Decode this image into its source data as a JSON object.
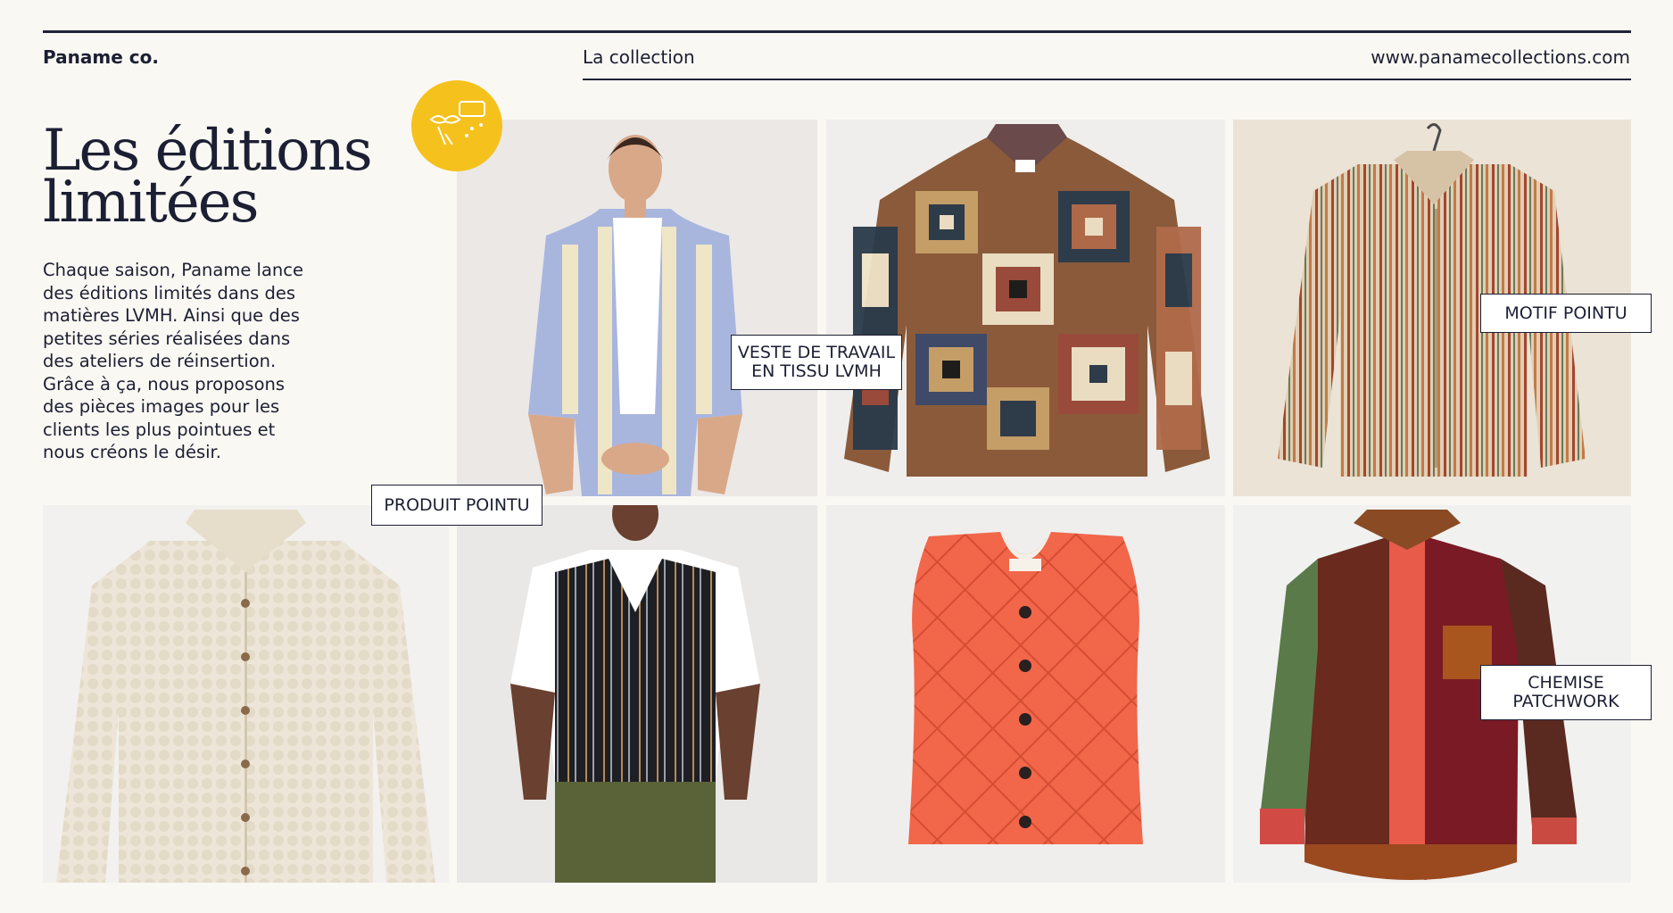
{
  "header": {
    "brand": "Paname co.",
    "nav_link": "La collection",
    "website": "www.panamecollections.com"
  },
  "intro": {
    "title_line1": "Les éditions",
    "title_line2": "limitées",
    "description": "Chaque saison, Paname lance des éditions limités dans des matières LVMH. Ainsi que des petites séries réalisées dans des ateliers de réinsertion. Grâce à ça, nous proposons des pièces images pour les clients les plus pointues et nous créons le désir."
  },
  "tags": {
    "veste_line1": "VESTE DE TRAVAIL",
    "veste_line2": "EN TISSU LVMH",
    "motif": "MOTIF POINTU",
    "produit": "PRODUIT POINTU",
    "chemise_line1": "CHEMISE",
    "chemise_line2": "PATCHWORK"
  },
  "colors": {
    "background": "#faf8f3",
    "ink": "#1c1f33",
    "badge": "#f5c11c"
  }
}
